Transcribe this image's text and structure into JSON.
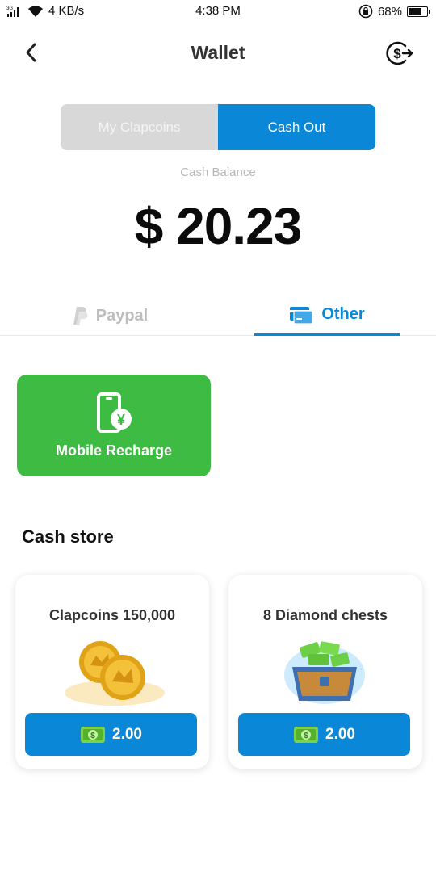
{
  "status_bar": {
    "network": "3G",
    "speed": "4 KB/s",
    "time": "4:38 PM",
    "battery": "68%",
    "battery_level": 0.68
  },
  "header": {
    "title": "Wallet",
    "back_icon": "chevron-left-icon",
    "exchange_icon": "dollar-exchange-icon"
  },
  "segment": {
    "tabs": [
      {
        "label": "My Clapcoins",
        "active": false
      },
      {
        "label": "Cash Out",
        "active": true
      }
    ]
  },
  "balance": {
    "label": "Cash Balance",
    "value": "$ 20.23"
  },
  "methods": {
    "tabs": [
      {
        "label": "Paypal",
        "icon": "paypal-icon",
        "active": false
      },
      {
        "label": "Other",
        "icon": "card-icon",
        "active": true
      }
    ]
  },
  "recharge": {
    "label": "Mobile Recharge",
    "icon": "phone-yen-icon"
  },
  "store": {
    "title": "Cash store",
    "items": [
      {
        "title": "Clapcoins 150,000",
        "price": "2.00",
        "icon": "coins-icon"
      },
      {
        "title": "8 Diamond chests",
        "price": "2.00",
        "icon": "chest-icon"
      }
    ]
  },
  "colors": {
    "primary": "#0a87d6",
    "green": "#3dbb43",
    "segment_inactive": "#d8d8d8"
  }
}
